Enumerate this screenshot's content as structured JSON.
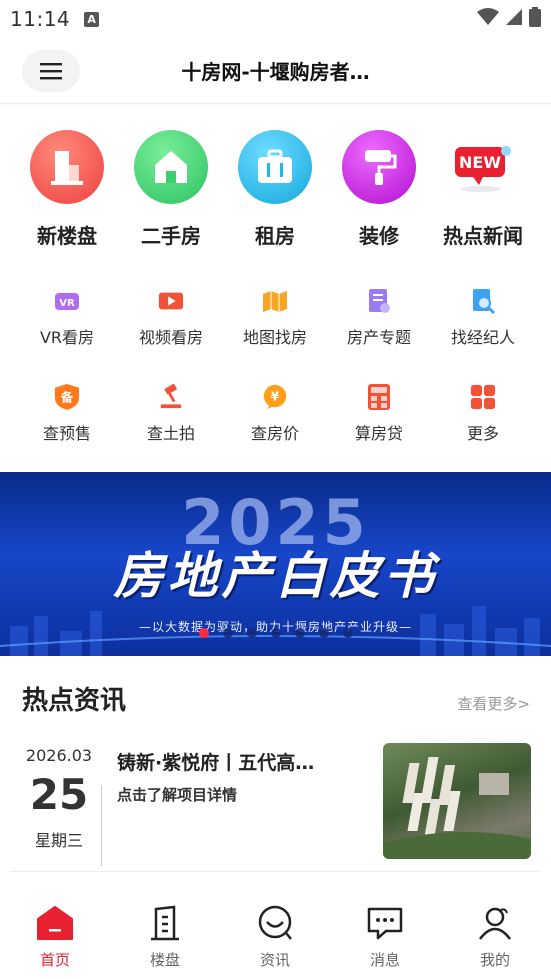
{
  "status_bar": {
    "time": "11:14",
    "a_badge": "A"
  },
  "header": {
    "title": "十房网-十堰购房者…",
    "menu_icon": "hamburger-menu-icon"
  },
  "big_categories": [
    {
      "label": "新楼盘",
      "icon": "building-icon",
      "color": "#f55a5a"
    },
    {
      "label": "二手房",
      "icon": "house-icon",
      "color": "#3ccf6e"
    },
    {
      "label": "租房",
      "icon": "suitcase-icon",
      "color": "#1fb8e8"
    },
    {
      "label": "装修",
      "icon": "paint-roller-icon",
      "color": "#c51ee0"
    },
    {
      "label": "热点新闻",
      "icon": "new-badge-icon",
      "color": "#e8202f"
    }
  ],
  "small_row_1": [
    {
      "label": "VR看房",
      "icon": "vr-icon"
    },
    {
      "label": "视频看房",
      "icon": "video-icon"
    },
    {
      "label": "地图找房",
      "icon": "map-icon"
    },
    {
      "label": "房产专题",
      "icon": "document-icon"
    },
    {
      "label": "找经纪人",
      "icon": "agent-search-icon"
    }
  ],
  "small_row_2": [
    {
      "label": "查预售",
      "icon": "presale-badge-icon",
      "badge_text": "备"
    },
    {
      "label": "查土拍",
      "icon": "auction-hammer-icon"
    },
    {
      "label": "查房价",
      "icon": "price-coin-icon",
      "badge_text": "¥"
    },
    {
      "label": "算房贷",
      "icon": "calculator-icon"
    },
    {
      "label": "更多",
      "icon": "grid-more-icon"
    }
  ],
  "banner": {
    "year": "2025",
    "title": "房地产白皮书",
    "subtitle": "—以大数据为驱动，助力十堰房地产产业升级—",
    "dot_count": 7,
    "active_dot": 0
  },
  "hot_news": {
    "title": "热点资讯",
    "more": "查看更多>",
    "items": [
      {
        "year_month": "2026.03",
        "day": "25",
        "weekday": "星期三",
        "title": "铸新·紫悦府丨五代高…",
        "description": "点击了解项目详情"
      }
    ]
  },
  "bottom_nav": [
    {
      "label": "首页",
      "icon": "home-icon",
      "active": true
    },
    {
      "label": "楼盘",
      "icon": "building-outline-icon",
      "active": false
    },
    {
      "label": "资讯",
      "icon": "news-chat-icon",
      "active": false
    },
    {
      "label": "消息",
      "icon": "message-icon",
      "active": false
    },
    {
      "label": "我的",
      "icon": "user-icon",
      "active": false
    }
  ],
  "colors": {
    "accent": "#e8202f",
    "banner_blue": "#1746c8"
  }
}
